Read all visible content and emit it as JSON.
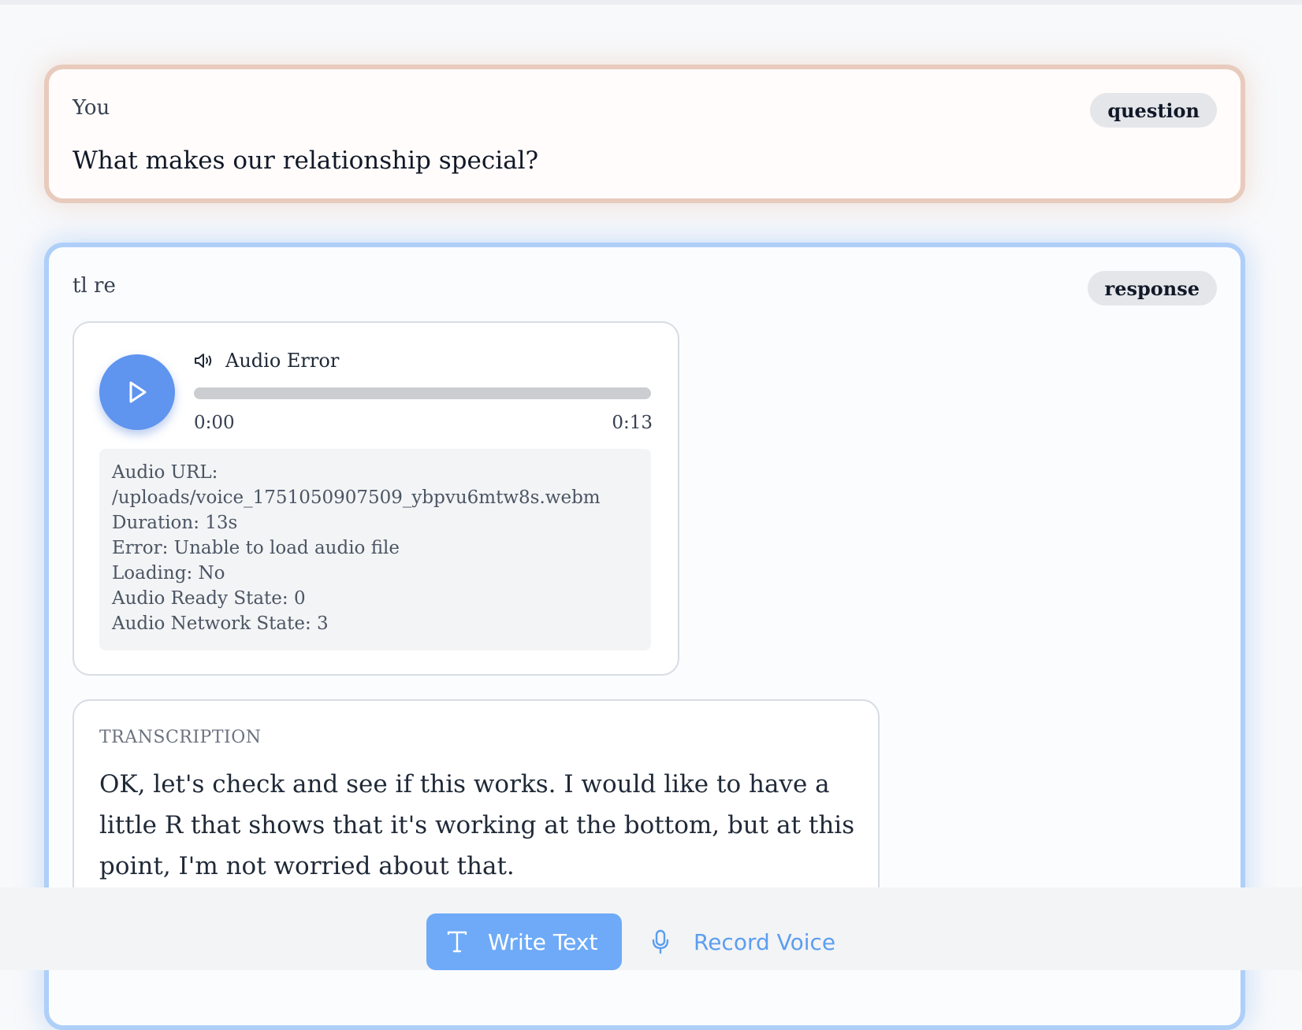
{
  "question_card": {
    "author": "You",
    "tag": "question",
    "text": "What makes our relationship special?"
  },
  "response_card": {
    "author": "tl re",
    "tag": "response",
    "audio": {
      "title": "Audio Error",
      "time_current": "0:00",
      "time_total": "0:13",
      "progress": 0,
      "debug_lines": [
        "Audio URL:",
        "/uploads/voice_1751050907509_ybpvu6mtw8s.webm",
        "Duration: 13s",
        "Error: Unable to load audio file",
        "Loading: No",
        "Audio Ready State: 0",
        "Audio Network State: 3"
      ]
    },
    "transcription": {
      "label": "TRANSCRIPTION",
      "text": "OK, let's check and see if this works. I would like to have a little R that shows that it's working at the bottom, but at this point, I'm not worried about that."
    }
  },
  "bottom_bar": {
    "write_text_label": "Write Text",
    "record_voice_label": "Record Voice"
  },
  "colors": {
    "question_border": "#e8cbbd",
    "response_border": "#aecff8",
    "accent_blue": "#5f94ef",
    "write_button": "#6eaaf7",
    "record_text": "#5c9ef0"
  },
  "icons": {
    "play": "play-icon",
    "speaker": "speaker-icon",
    "text": "text-icon",
    "microphone": "microphone-icon"
  }
}
